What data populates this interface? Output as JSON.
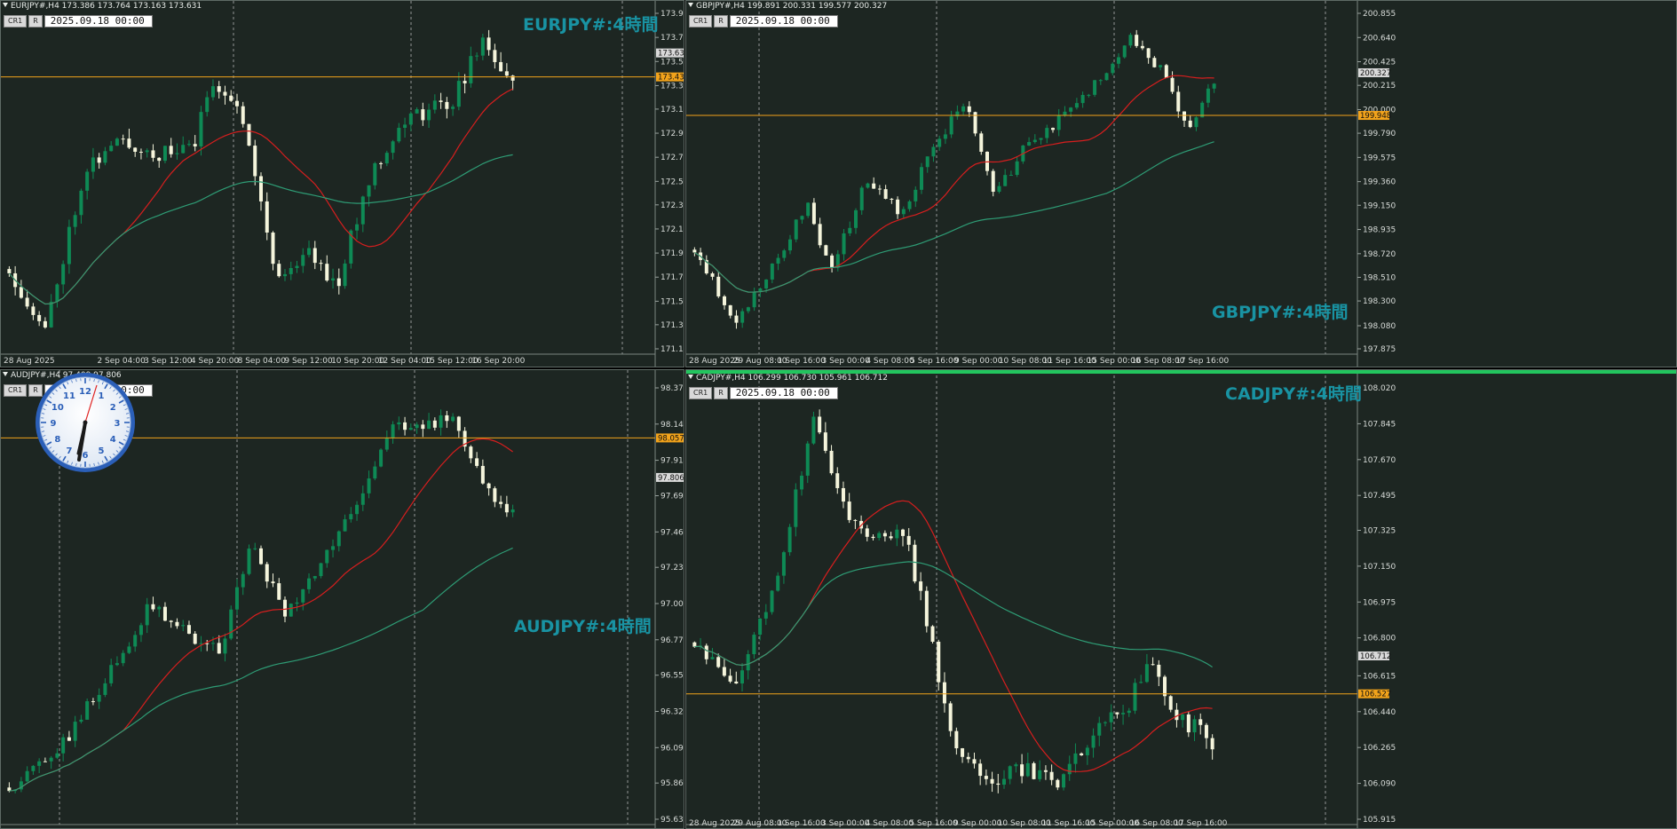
{
  "colors": {
    "bg": "#1d2622",
    "grid": "#c8c8c8",
    "up": "#0e8a55",
    "down": "#f5f5dc",
    "ma_fast": "#d81e1e",
    "ma_slow": "#2e9c75",
    "level": "#f2a31b",
    "axis_text": "#d8dcd9",
    "symbol_label": "#1993a3"
  },
  "clock": {
    "hour_digits": [
      "12",
      "1",
      "2",
      "3",
      "4",
      "5",
      "6",
      "7",
      "8",
      "9",
      "10",
      "11"
    ]
  },
  "charts": [
    {
      "id": "eurjpy",
      "header": "EURJPY#,H4  173.386 173.764 173.163 173.631",
      "btn_cr": "CR1",
      "btn_r": "R",
      "date": "2025.09.18 00:00",
      "symbol_label": "EURJPY#:4時間",
      "price_ticks": [
        "173.960",
        "173.760",
        "173.560",
        "173.360",
        "173.165",
        "172.965",
        "172.765",
        "172.565",
        "172.370",
        "172.170",
        "171.970",
        "171.770",
        "171.570",
        "171.375",
        "171.175"
      ],
      "tick_range": [
        173.96,
        171.175
      ],
      "current_price": "173.631",
      "current_value": 173.631,
      "level_price": "173.432",
      "level_value": 173.432,
      "time_labels": [
        "28 Aug 2025",
        "",
        "2 Sep 04:00",
        "3 Sep 12:00",
        "4 Sep 20:00",
        "8 Sep 04:00",
        "9 Sep 12:00",
        "10 Sep 20:00",
        "12 Sep 04:00",
        "15 Sep 12:00",
        "16 Sep 20:00"
      ],
      "start": 171.6,
      "end": 173.55,
      "seed": 11,
      "shape": [
        [
          0,
          0
        ],
        [
          0.07,
          -0.35
        ],
        [
          0.15,
          0.55
        ],
        [
          0.22,
          0.7
        ],
        [
          0.3,
          0.62
        ],
        [
          0.37,
          0.68
        ],
        [
          0.4,
          1.05
        ],
        [
          0.47,
          0.8
        ],
        [
          0.53,
          -0.05
        ],
        [
          0.6,
          0.1
        ],
        [
          0.65,
          -0.1
        ],
        [
          0.72,
          0.55
        ],
        [
          0.79,
          0.82
        ],
        [
          0.88,
          0.92
        ],
        [
          0.94,
          1.25
        ],
        [
          1.0,
          1.0
        ]
      ]
    },
    {
      "id": "gbpjpy",
      "header": "GBPJPY#,H4  199.891 200.331 199.577 200.327",
      "btn_cr": "CR1",
      "btn_r": "R",
      "date": "2025.09.18 00:00",
      "symbol_label": "GBPJPY#:4時間",
      "price_ticks": [
        "200.855",
        "200.640",
        "200.425",
        "200.215",
        "200.000",
        "199.790",
        "199.575",
        "199.360",
        "199.150",
        "198.935",
        "198.720",
        "198.510",
        "198.300",
        "198.080",
        "197.875"
      ],
      "tick_range": [
        200.855,
        197.875
      ],
      "current_price": "200.327",
      "current_value": 200.327,
      "level_price": "199.948",
      "level_value": 199.948,
      "time_labels": [
        "28 Aug 2025",
        "29 Aug 08:00",
        "1 Sep 16:00",
        "3 Sep 00:00",
        "4 Sep 08:00",
        "5 Sep 16:00",
        "9 Sep 00:00",
        "10 Sep 08:00",
        "11 Sep 16:00",
        "15 Sep 00:00",
        "16 Sep 08:00",
        "17 Sep 16:00"
      ],
      "start": 198.85,
      "end": 200.25,
      "seed": 23,
      "shape": [
        [
          0,
          0
        ],
        [
          0.08,
          -0.6
        ],
        [
          0.15,
          -0.15
        ],
        [
          0.22,
          0.4
        ],
        [
          0.26,
          -0.2
        ],
        [
          0.33,
          0.55
        ],
        [
          0.4,
          0.3
        ],
        [
          0.46,
          0.85
        ],
        [
          0.52,
          1.2
        ],
        [
          0.58,
          0.45
        ],
        [
          0.63,
          0.8
        ],
        [
          0.7,
          1.05
        ],
        [
          0.76,
          1.3
        ],
        [
          0.84,
          1.75
        ],
        [
          0.9,
          1.45
        ],
        [
          0.95,
          0.95
        ],
        [
          1.0,
          1.4
        ]
      ]
    },
    {
      "id": "audjpy",
      "header": "AUDJPY#,H4  97.409 97.806",
      "btn_cr": "CR1",
      "btn_r": "R",
      "date": "2025.09.18 00:00",
      "symbol_label": "AUDJPY#:4時間",
      "price_ticks": [
        "98.375",
        "98.145",
        "97.915",
        "97.690",
        "97.460",
        "97.235",
        "97.005",
        "96.775",
        "96.550",
        "96.320",
        "96.090",
        "95.865",
        "95.635"
      ],
      "tick_range": [
        98.375,
        95.635
      ],
      "current_price": "97.806",
      "current_value": 97.806,
      "level_price": "98.057",
      "level_value": 98.057,
      "time_labels": [
        "",
        "",
        "",
        "",
        "",
        "",
        "",
        "",
        "",
        "",
        ""
      ],
      "start": 95.85,
      "end": 97.6,
      "seed": 37,
      "shape": [
        [
          0,
          0
        ],
        [
          0.1,
          0.25
        ],
        [
          0.2,
          0.75
        ],
        [
          0.28,
          1.2
        ],
        [
          0.36,
          1.0
        ],
        [
          0.42,
          0.9
        ],
        [
          0.48,
          1.6
        ],
        [
          0.55,
          1.15
        ],
        [
          0.62,
          1.45
        ],
        [
          0.7,
          1.95
        ],
        [
          0.76,
          2.4
        ],
        [
          0.82,
          2.35
        ],
        [
          0.88,
          2.45
        ],
        [
          0.94,
          2.0
        ],
        [
          1.0,
          1.8
        ]
      ]
    },
    {
      "id": "cadjpy",
      "header": "CADJPY#,H4  106.299 106.730 105.961 106.712",
      "btn_cr": "CR1",
      "btn_r": "R",
      "date": "2025.09.18 00:00",
      "symbol_label": "CADJPY#:4時間",
      "price_ticks": [
        "108.020",
        "107.845",
        "107.670",
        "107.495",
        "107.325",
        "107.150",
        "106.975",
        "106.800",
        "106.615",
        "106.440",
        "106.265",
        "106.090",
        "105.915"
      ],
      "tick_range": [
        108.02,
        105.915
      ],
      "current_price": "106.712",
      "current_value": 106.712,
      "level_price": "106.527",
      "level_value": 106.527,
      "time_labels": [
        "28 Aug 2025",
        "29 Aug 08:00",
        "1 Sep 16:00",
        "3 Sep 00:00",
        "4 Sep 08:00",
        "5 Sep 16:00",
        "9 Sep 00:00",
        "10 Sep 08:00",
        "11 Sep 16:00",
        "15 Sep 00:00",
        "16 Sep 08:00",
        "17 Sep 16:00"
      ],
      "start": 106.9,
      "end": 106.5,
      "seed": 53,
      "shape": [
        [
          0,
          0
        ],
        [
          0.08,
          -0.2
        ],
        [
          0.16,
          0.35
        ],
        [
          0.23,
          1.15
        ],
        [
          0.28,
          0.7
        ],
        [
          0.34,
          0.5
        ],
        [
          0.4,
          0.6
        ],
        [
          0.45,
          0.1
        ],
        [
          0.5,
          -0.55
        ],
        [
          0.56,
          -0.7
        ],
        [
          0.64,
          -0.65
        ],
        [
          0.71,
          -0.7
        ],
        [
          0.78,
          -0.45
        ],
        [
          0.84,
          -0.3
        ],
        [
          0.88,
          -0.1
        ],
        [
          0.92,
          -0.35
        ],
        [
          1.0,
          -0.5
        ]
      ]
    }
  ]
}
